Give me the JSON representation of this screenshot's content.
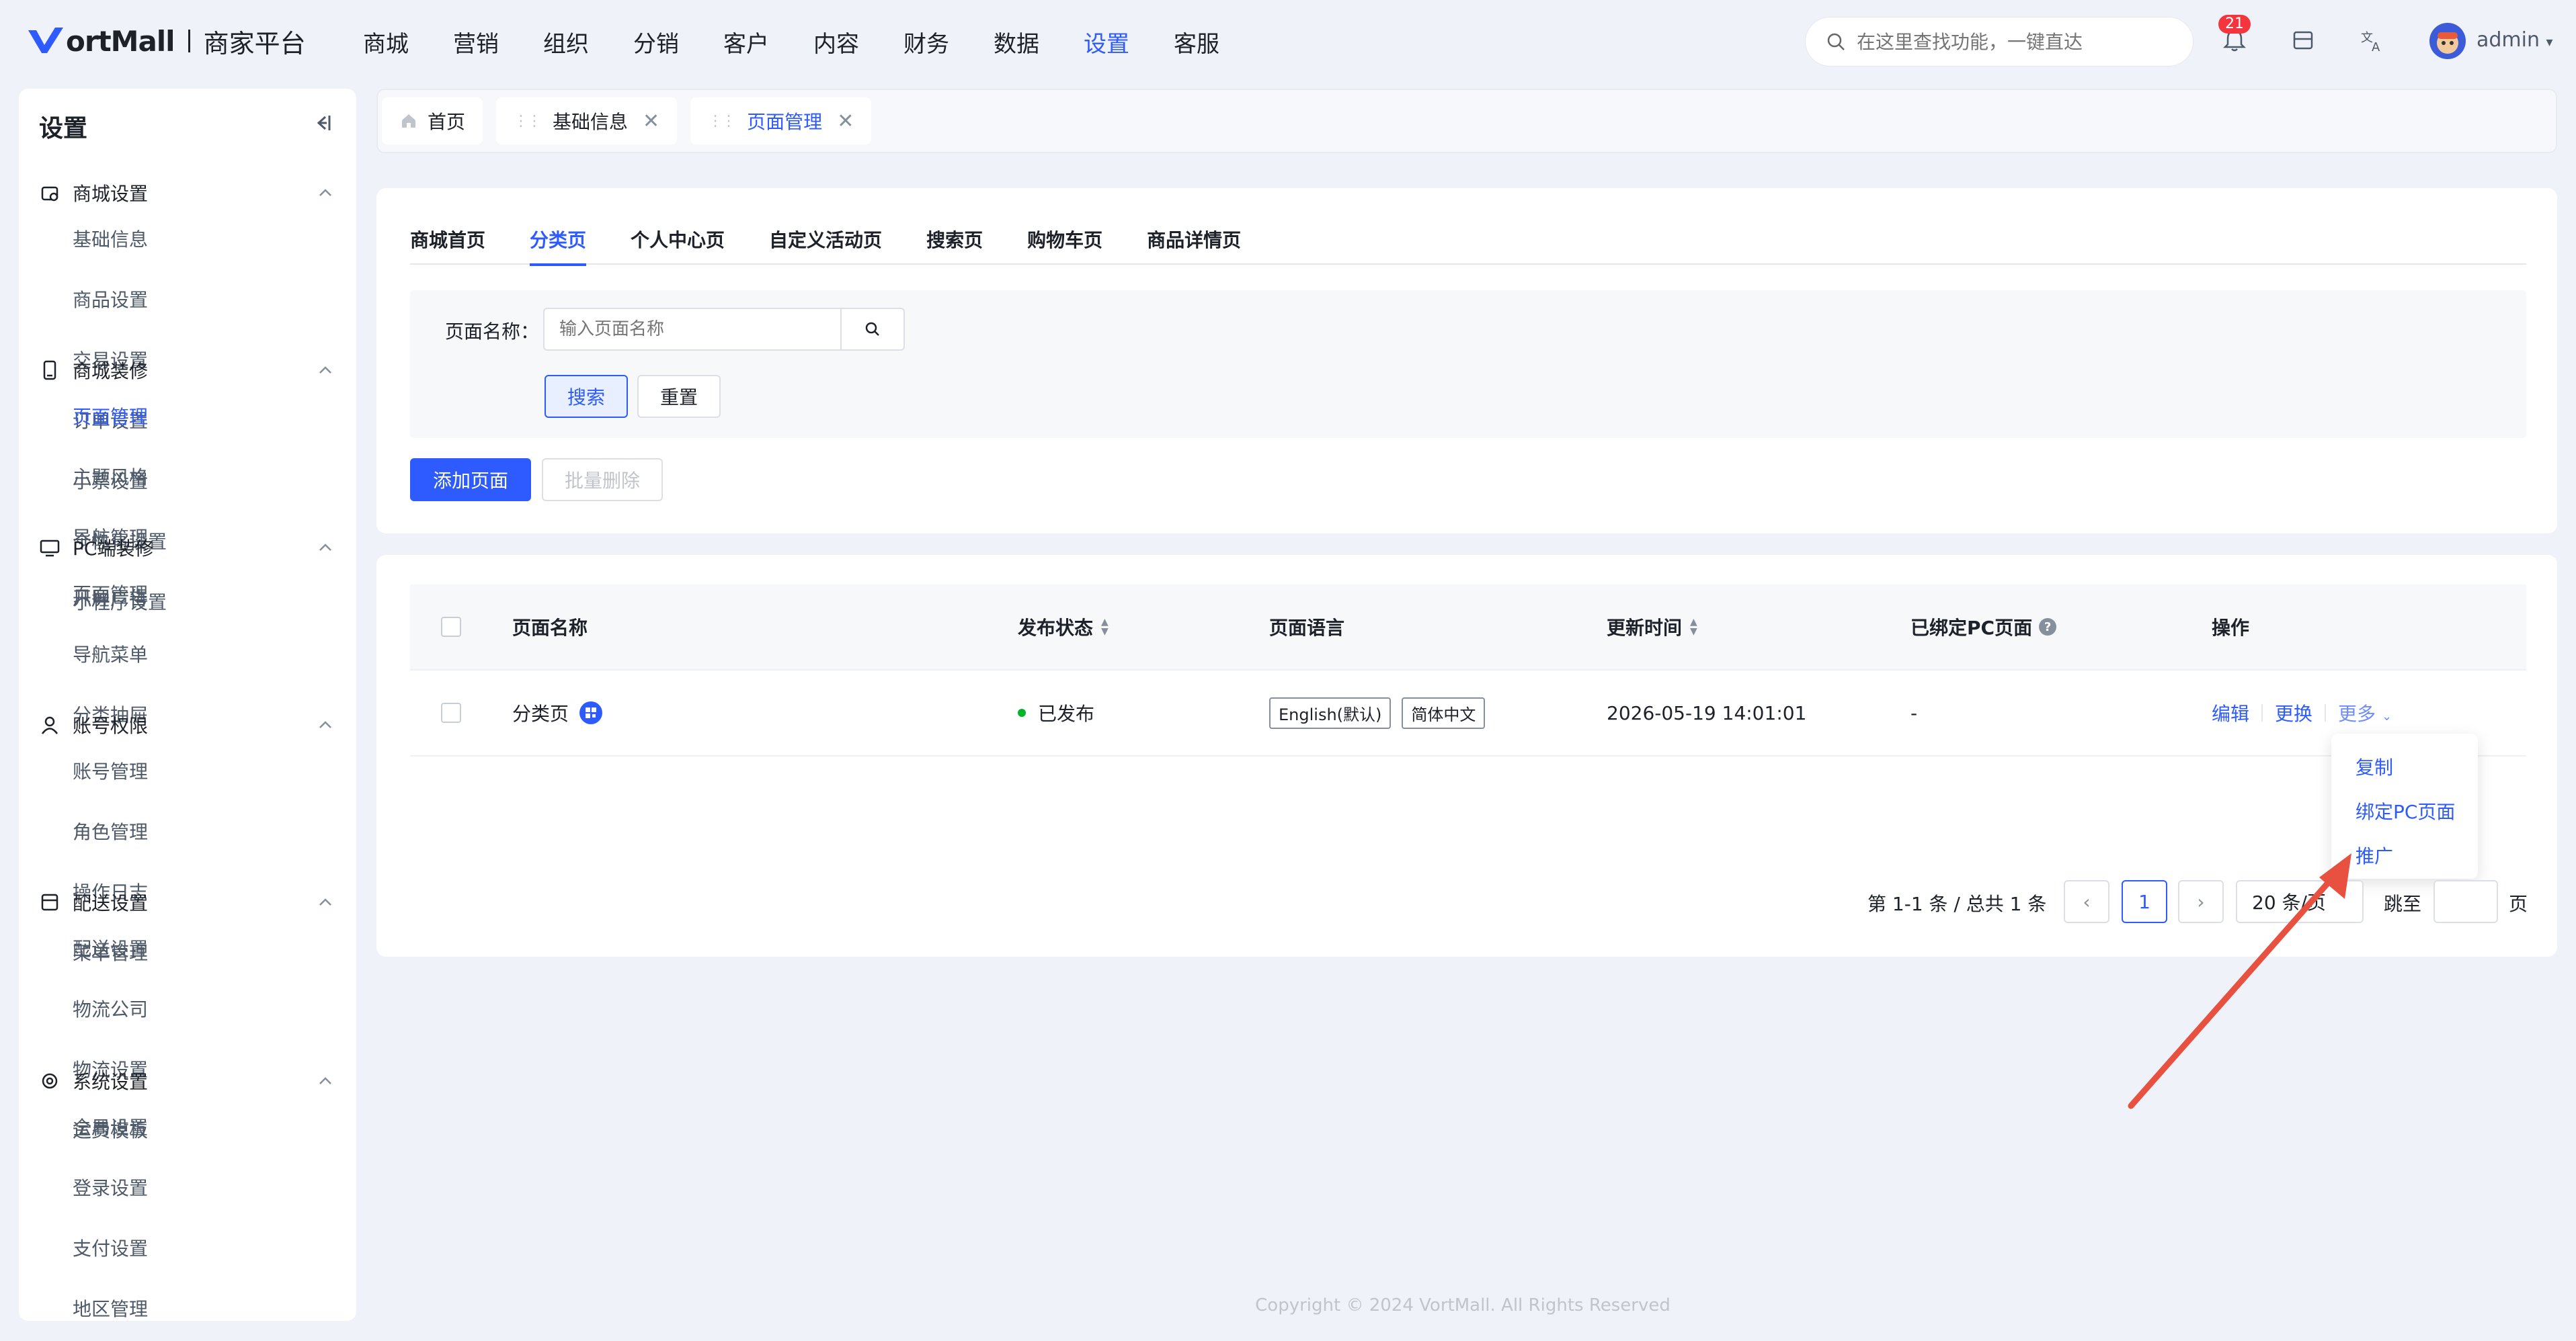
{
  "brand": {
    "logo_text": "ortMall",
    "sub": "商家平台"
  },
  "topnav": [
    "商城",
    "营销",
    "组织",
    "分销",
    "客户",
    "内容",
    "财务",
    "数据",
    "设置",
    "客服"
  ],
  "topnav_active": 8,
  "search": {
    "placeholder": "在这里查找功能，一键直达"
  },
  "notification_badge": "21",
  "user": {
    "name": "admin"
  },
  "sidebar": {
    "title": "设置",
    "groups": [
      {
        "label": "商城设置",
        "icon": "shop-settings-icon",
        "items": [
          "基础信息",
          "商品设置",
          "交易设置",
          "订单设置",
          "小票设置",
          "个性化设置",
          "小程序设置"
        ]
      },
      {
        "label": "商城装修",
        "icon": "mobile-icon",
        "items": [
          "页面管理",
          "主题风格",
          "导航管理",
          "开屏广告"
        ]
      },
      {
        "label": "PC端装修",
        "icon": "monitor-icon",
        "items": [
          "页面管理",
          "导航菜单",
          "分类抽屉"
        ]
      },
      {
        "label": "账号权限",
        "icon": "user-icon",
        "items": [
          "账号管理",
          "角色管理",
          "操作日志",
          "菜单管理"
        ]
      },
      {
        "label": "配送设置",
        "icon": "delivery-icon",
        "items": [
          "配送设置",
          "物流公司",
          "物流设置",
          "运费模板"
        ]
      },
      {
        "label": "系统设置",
        "icon": "system-icon",
        "items": [
          "全局设置",
          "登录设置",
          "支付设置",
          "地区管理"
        ]
      }
    ]
  },
  "tabs": [
    {
      "label": "首页"
    },
    {
      "label": "基础信息"
    },
    {
      "label": "页面管理"
    }
  ],
  "subtabs": [
    "商城首页",
    "分类页",
    "个人中心页",
    "自定义活动页",
    "搜索页",
    "购物车页",
    "商品详情页"
  ],
  "subtab_active": 1,
  "filter": {
    "label": "页面名称：",
    "placeholder": "输入页面名称",
    "search_btn": "搜索",
    "reset_btn": "重置"
  },
  "actions": {
    "add": "添加页面",
    "batch_delete": "批量删除"
  },
  "table": {
    "columns": [
      "页面名称",
      "发布状态",
      "页面语言",
      "更新时间",
      "已绑定PC页面",
      "操作"
    ],
    "rows": [
      {
        "name": "分类页",
        "status": "已发布",
        "languages": [
          "English(默认)",
          "简体中文"
        ],
        "updated": "2026-05-19 14:01:01",
        "pc_page": "-",
        "ops": [
          "编辑",
          "更换",
          "更多"
        ]
      }
    ]
  },
  "dropdown": [
    "复制",
    "绑定PC页面",
    "推广"
  ],
  "pagination": {
    "summary": "第 1-1 条 / 总共 1 条",
    "current": "1",
    "page_size": "20 条/页",
    "jump_label": "跳至",
    "page_suffix": "页"
  },
  "footer": "Copyright © 2024 VortMall. All Rights Reserved",
  "colors": {
    "primary": "#2d5bff",
    "annotation_arrow": "#e8503f"
  }
}
